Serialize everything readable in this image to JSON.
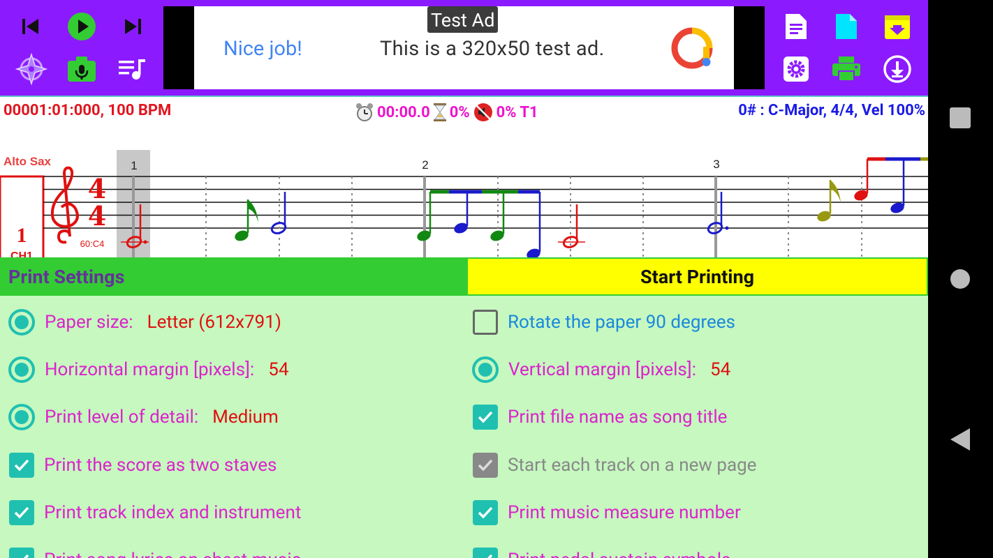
{
  "toolbar": {
    "icons": [
      "skip-previous-icon",
      "play-icon",
      "skip-next-icon",
      "compass-icon",
      "camera-mic-icon",
      "playlist-icon",
      "text-document-icon",
      "blank-document-icon",
      "archive-icon",
      "settings-icon",
      "print-icon",
      "download-icon"
    ],
    "colors": {
      "background": "#8c1aff",
      "green": "#33cc33",
      "cyan": "#00e5ff",
      "yellow": "#ffff00"
    }
  },
  "ad": {
    "tag": "Test Ad",
    "headline": "Nice job!",
    "body": "This is a 320x50 test ad."
  },
  "info": {
    "position": "00001:01:000, 100 BPM",
    "time": "00:00.0",
    "progress": "0%",
    "volume": "0% T1",
    "key": "0# : C-Major, 4/4, Vel 100%"
  },
  "score": {
    "instrument": "Alto Sax",
    "track_number": "1",
    "channel": "CH1",
    "time_signature_top": "4",
    "time_signature_bottom": "4",
    "note_label": "60:C4",
    "measures": [
      "1",
      "2",
      "3"
    ]
  },
  "settings": {
    "title": "Print Settings",
    "start_button": "Start Printing",
    "left": [
      {
        "type": "radio",
        "label": "Paper size:",
        "value": "Letter (612x791)"
      },
      {
        "type": "radio",
        "label": "Horizontal margin [pixels]:",
        "value": "54"
      },
      {
        "type": "radio",
        "label": "Print level of detail:",
        "value": "Medium"
      },
      {
        "type": "check",
        "label": "Print the score as two staves"
      },
      {
        "type": "check",
        "label": "Print track index and instrument"
      },
      {
        "type": "check",
        "label": "Print song lyrics on sheet music"
      }
    ],
    "right": [
      {
        "type": "check-empty",
        "label": "Rotate the paper 90 degrees"
      },
      {
        "type": "radio",
        "label": "Vertical margin [pixels]:",
        "value": "54"
      },
      {
        "type": "check",
        "label": "Print file name as song title"
      },
      {
        "type": "check-disabled",
        "label": "Start each track on a new page"
      },
      {
        "type": "check",
        "label": "Print music measure number"
      },
      {
        "type": "check",
        "label": "Print pedal sustain symbols"
      }
    ]
  },
  "navbar": {
    "icons": [
      "recents-icon",
      "home-icon",
      "back-icon"
    ]
  }
}
